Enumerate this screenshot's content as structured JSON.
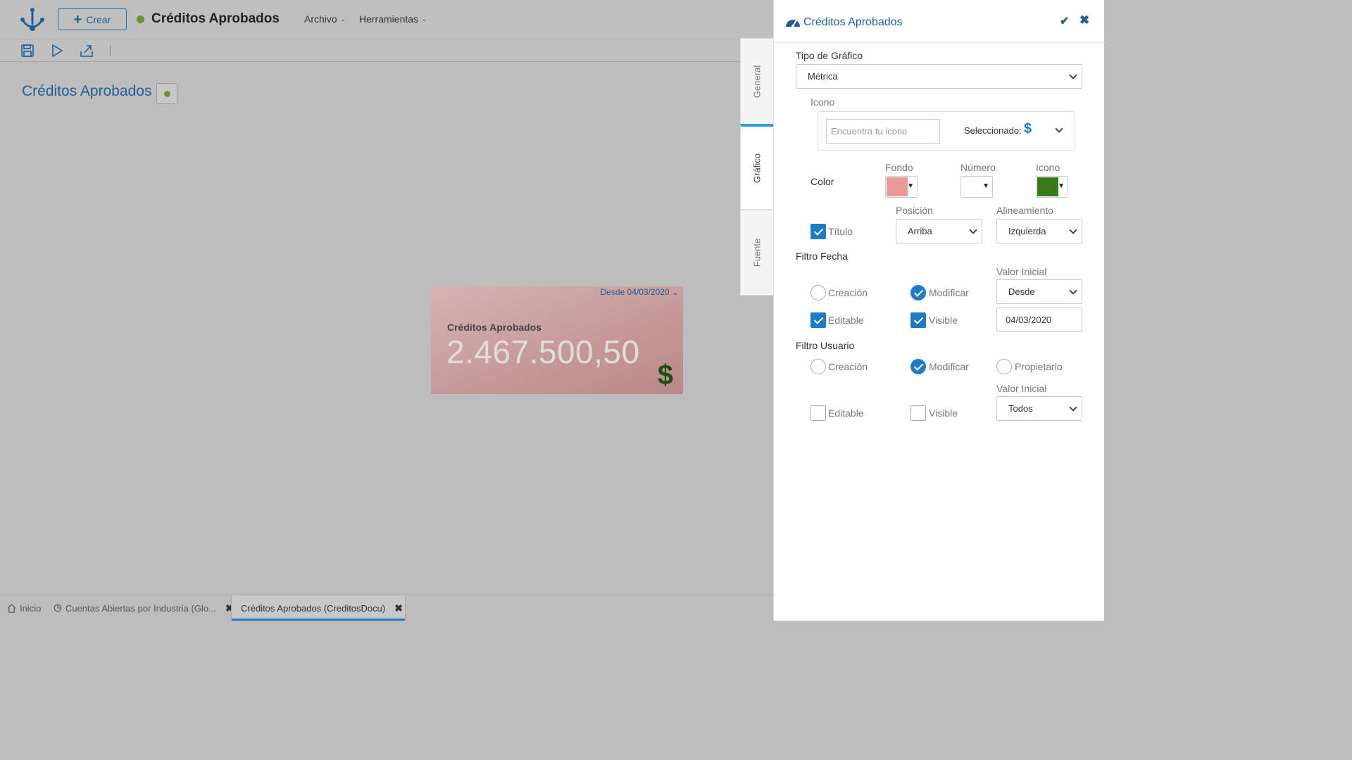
{
  "topbar": {
    "crear_label": "Crear",
    "title": "Créditos Aprobados",
    "menus": [
      "Archivo",
      "Herramientas"
    ]
  },
  "page": {
    "title": "Créditos Aprobados"
  },
  "metric": {
    "filter_label": "Desde 04/03/2020",
    "title": "Créditos Aprobados",
    "value": "2.467.500,50",
    "icon": "$"
  },
  "bottom_tabs": [
    {
      "label": "Inicio",
      "icon": "home-icon"
    },
    {
      "label": "Cuentas Abiertas por Industria (Glo...",
      "icon": "chart-pie-icon",
      "closable": true
    },
    {
      "label": "Créditos Aprobados (CreditosDocu)",
      "icon": "chart-pie-icon",
      "closable": true,
      "active": true
    }
  ],
  "side_tabs": [
    "General",
    "Gráfico",
    "Fuente"
  ],
  "panel": {
    "title": "Créditos Aprobados",
    "tipo_label": "Tipo de Gráfico",
    "tipo_value": "Métrica",
    "icono_label": "Icono",
    "icono_search_placeholder": "Encuentra tu icono",
    "seleccionado_label": "Seleccionado:",
    "seleccionado_icon": "$",
    "color_label": "Color",
    "fondo_label": "Fondo",
    "numero_label": "Número",
    "icono_color_label": "Icono",
    "colors": {
      "fondo": "#e89a9a",
      "numero": "#ffffff",
      "icono": "#3a7a1e",
      "accent": "#1e7bc4"
    },
    "titulo_label": "Título",
    "titulo_checked": true,
    "posicion_label": "Posición",
    "posicion_value": "Arriba",
    "alineamiento_label": "Alineamiento",
    "alineamiento_value": "Izquierda",
    "filtro_fecha": {
      "label": "Filtro Fecha",
      "valor_inicial_label": "Valor Inicial",
      "creacion_label": "Creación",
      "creacion_checked": false,
      "modificar_label": "Modificar",
      "modificar_checked": true,
      "valor_inicial_value": "Desde",
      "editable_label": "Editable",
      "editable_checked": true,
      "visible_label": "Visible",
      "visible_checked": true,
      "date_value": "04/03/2020"
    },
    "filtro_usuario": {
      "label": "Filtro Usuario",
      "creacion_label": "Creación",
      "creacion_checked": false,
      "modificar_label": "Modificar",
      "modificar_checked": true,
      "propietario_label": "Propietario",
      "propietario_checked": false,
      "valor_inicial_label": "Valor Inicial",
      "editable_label": "Editable",
      "editable_checked": false,
      "visible_label": "Visible",
      "visible_checked": false,
      "valor_inicial_value": "Todos"
    }
  }
}
